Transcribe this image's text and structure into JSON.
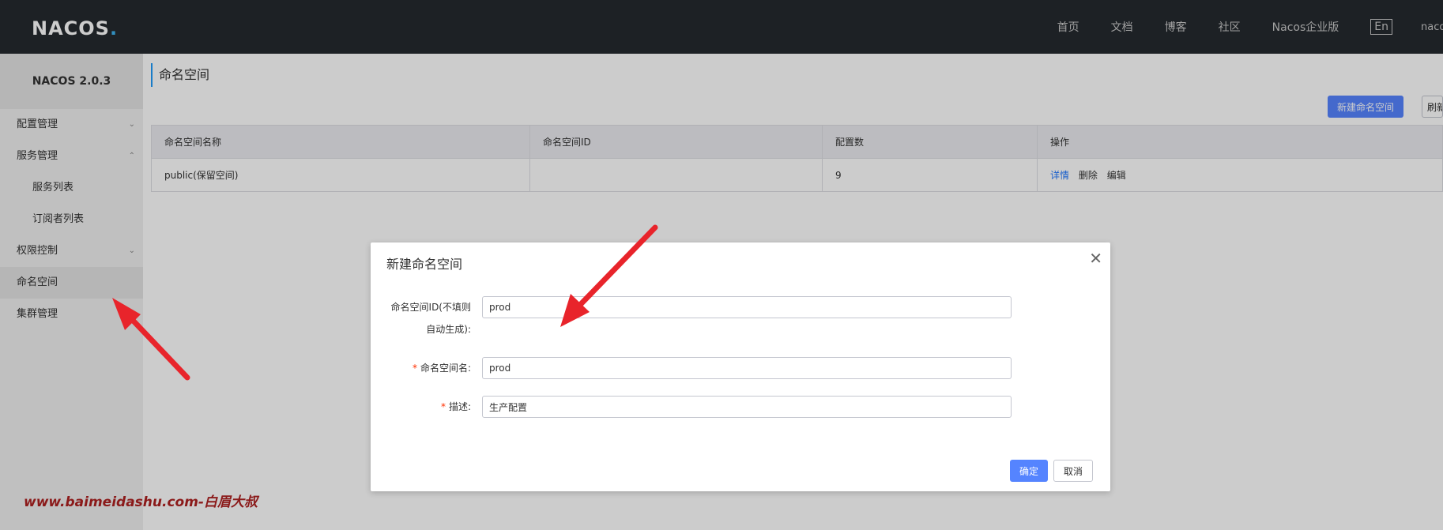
{
  "app": {
    "logo": "NACOS",
    "logo_dot": "."
  },
  "nav": {
    "items": [
      {
        "label": "首页"
      },
      {
        "label": "文档"
      },
      {
        "label": "博客"
      },
      {
        "label": "社区"
      },
      {
        "label": "Nacos企业版"
      }
    ],
    "lang": "En",
    "user": "nacos"
  },
  "sidebar": {
    "version": "NACOS 2.0.3",
    "items": [
      {
        "label": "配置管理",
        "chevron": "chevron-down-icon"
      },
      {
        "label": "服务管理",
        "chevron": "chevron-up-icon"
      },
      {
        "label": "服务列表"
      },
      {
        "label": "订阅者列表"
      },
      {
        "label": "权限控制",
        "chevron": "chevron-down-icon"
      },
      {
        "label": "命名空间"
      },
      {
        "label": "集群管理"
      }
    ]
  },
  "main": {
    "title": "命名空间",
    "new_button": "新建命名空间",
    "refresh_button": "刷新",
    "table": {
      "columns": [
        "命名空间名称",
        "命名空间ID",
        "配置数",
        "操作"
      ],
      "rows": [
        {
          "name": "public(保留空间)",
          "id": "",
          "count": "9",
          "actions": [
            "详情",
            "删除",
            "编辑"
          ]
        }
      ]
    }
  },
  "dialog": {
    "title": "新建命名空间",
    "fields": [
      {
        "label_line1": "命名空间ID(不填则",
        "label_line2": "自动生成):",
        "value": "prod",
        "required": false
      },
      {
        "label": "命名空间名:",
        "value": "prod",
        "required": true
      },
      {
        "label": "描述:",
        "value": "生产配置",
        "required": true
      }
    ],
    "ok_button": "确定",
    "cancel_button": "取消"
  },
  "watermark": "www.baimeidashu.com-白眉大叔",
  "colors": {
    "topbar": "#252a2f",
    "primary": "#5584ff",
    "link": "#2077ff",
    "required": "#ff3000",
    "arrow": "#e8242b"
  }
}
